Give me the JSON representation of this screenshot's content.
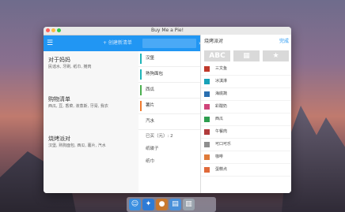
{
  "window": {
    "title": "Buy Me a Pie!"
  },
  "toolbar": {
    "add_list_placeholder": "+ 创建新清单",
    "add_item_arrow": "›"
  },
  "lists": [
    {
      "title": "对于妈妈",
      "subtitle": "民谣水, 牙刷, 纸巾, 摊肉"
    },
    {
      "title": "购物清单",
      "subtitle": "西瓜, 豆, 香菜, 液蒸斯, 牙膏, 我衣"
    },
    {
      "title": "烧烤派对",
      "subtitle": "汉堡, 熟狗面包, 西瓜, 薯片, 汽水"
    }
  ],
  "items": [
    {
      "label": "汉堡",
      "color": "#1fb4b8"
    },
    {
      "label": "熟狗面包",
      "color": "#1fb4b8"
    },
    {
      "label": "西瓜",
      "color": "#4caf50"
    },
    {
      "label": "薯片",
      "color": "#f07b2f"
    },
    {
      "label": "汽水",
      "color": "#ffffff"
    }
  ],
  "info": {
    "bought": "已买（元）: 2",
    "other1": "纸碟子",
    "other2": "纸巾"
  },
  "panel": {
    "title": "烧烤派对",
    "done": "完成",
    "segments": [
      "ABC",
      "▦",
      "★"
    ],
    "colors": [
      {
        "label": "三文鱼",
        "color": "#c0392b"
      },
      {
        "label": "冰淇淋",
        "color": "#17a2b8"
      },
      {
        "label": "海底蔬",
        "color": "#2a6fb0"
      },
      {
        "label": "彩酸奶",
        "color": "#d0447a"
      },
      {
        "label": "西瓜",
        "color": "#2e9e4f"
      },
      {
        "label": "午餐肉",
        "color": "#b13b3b"
      },
      {
        "label": "可口可乐",
        "color": "#8e8e8e"
      },
      {
        "label": "咖啡",
        "color": "#e07b3a"
      },
      {
        "label": "蛋糕点",
        "color": "#e06a3a"
      }
    ]
  },
  "dock": {
    "icons": [
      "finder",
      "safari",
      "app",
      "folder",
      "trash"
    ]
  }
}
